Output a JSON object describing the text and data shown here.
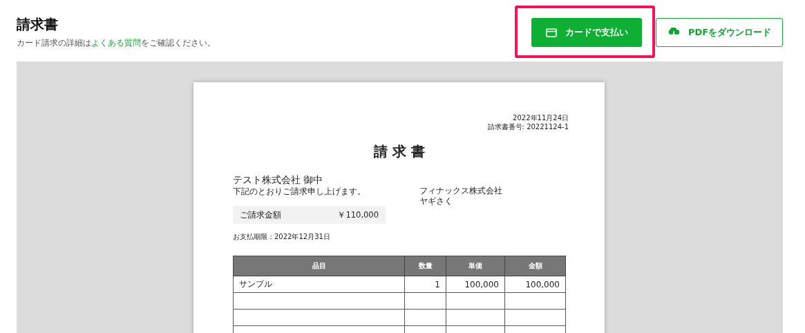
{
  "header": {
    "title": "請求書",
    "note_before": "カード請求の詳細は",
    "note_link": "よくある質問",
    "note_after": "をご確認ください。"
  },
  "buttons": [
    {
      "kind": "primary",
      "label": "カードで支払い",
      "highlighted": true
    },
    {
      "kind": "outline",
      "label": "PDFをダウンロード",
      "highlighted": false
    }
  ],
  "invoice": {
    "date": "2022年11月24日",
    "number": "請求書番号: 20221124-1",
    "title": "請 求 書",
    "recipient": "テスト株式会社 御中",
    "greeting": "下記のとおりご請求申し上げます。",
    "amount_label": "ご請求金額",
    "amount": "￥110,000",
    "due": "お支払期限：2022年12月31日",
    "issuer": "フィナックス株式会社",
    "issuer_person": "ヤギさく",
    "table": {
      "columns": [
        "品目",
        "数量",
        "単価",
        "金額"
      ],
      "rows": [
        [
          "サンプル",
          "1",
          "100,000",
          "100,000"
        ]
      ]
    }
  }
}
